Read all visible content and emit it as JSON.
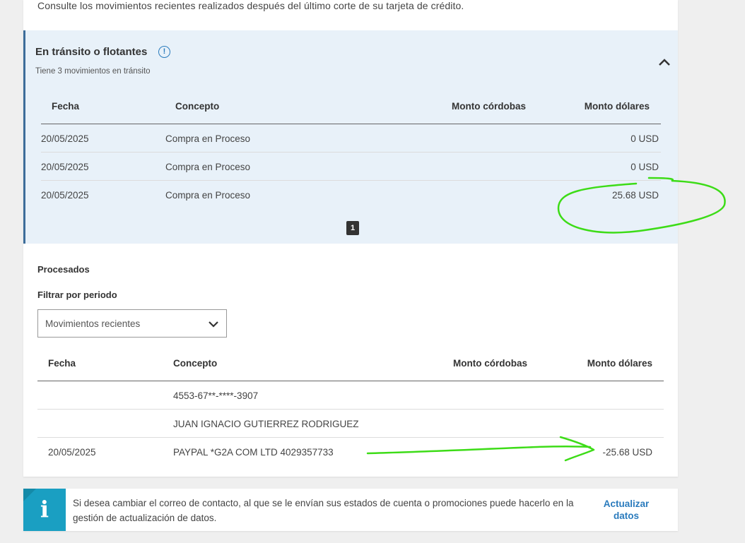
{
  "intro_text": "Consulte los movimientos recientes realizados después del último corte de su tarjeta de crédito.",
  "transit": {
    "title": "En tránsito o flotantes",
    "info_icon_glyph": "!",
    "subtitle": "Tiene 3 movimientos en tránsito",
    "columns": [
      "Fecha",
      "Concepto",
      "Monto córdobas",
      "Monto dólares"
    ],
    "rows": [
      {
        "fecha": "20/05/2025",
        "concepto": "Compra en Proceso",
        "cordobas": "",
        "dolares": "0 USD"
      },
      {
        "fecha": "20/05/2025",
        "concepto": "Compra en Proceso",
        "cordobas": "",
        "dolares": "0 USD"
      },
      {
        "fecha": "20/05/2025",
        "concepto": "Compra en Proceso",
        "cordobas": "",
        "dolares": "25.68 USD"
      }
    ],
    "page": "1"
  },
  "processed": {
    "title": "Procesados",
    "filter_label": "Filtrar por periodo",
    "filter_value": "Movimientos recientes",
    "columns": [
      "Fecha",
      "Concepto",
      "Monto córdobas",
      "Monto dólares"
    ],
    "rows": [
      {
        "fecha": "",
        "concepto": "4553-67**-****-3907",
        "cordobas": "",
        "dolares": ""
      },
      {
        "fecha": "",
        "concepto": "JUAN IGNACIO GUTIERREZ RODRIGUEZ",
        "cordobas": "",
        "dolares": ""
      },
      {
        "fecha": "20/05/2025",
        "concepto": "PAYPAL *G2A COM LTD 4029357733",
        "cordobas": "",
        "dolares": "-25.68 USD"
      }
    ]
  },
  "banner": {
    "icon_glyph": "i",
    "text": "Si desea cambiar el correo de contacto, al que se le envían sus estados de cuenta o promociones puede hacerlo en la gestión de actualización de datos.",
    "link_label": "Actualizar datos"
  },
  "colors": {
    "accent_blue": "#2a7bbd",
    "transit_bg": "#e8f1f9",
    "banner_icon_bg": "#1a9fc2",
    "annotation_green": "#3ddc17"
  },
  "icons": {
    "info": "info-circle-icon",
    "collapse": "chevron-up-icon",
    "dropdown": "chevron-down-icon",
    "banner": "info-square-icon"
  }
}
